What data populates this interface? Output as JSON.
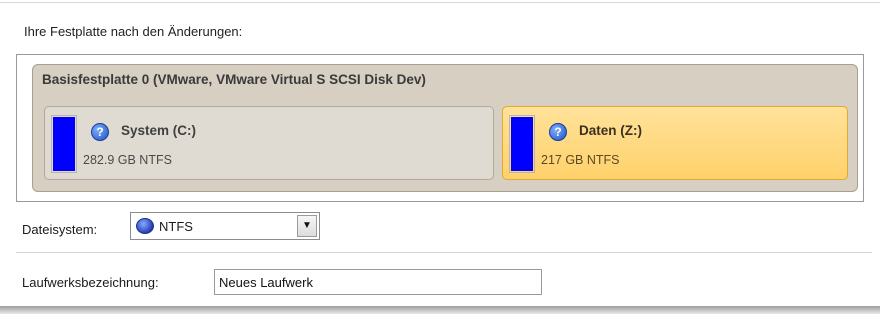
{
  "header": {
    "caption": "Ihre Festplatte nach den Änderungen:"
  },
  "disk": {
    "title": "Basisfestplatte 0 (VMware, VMware Virtual S SCSI Disk Dev)",
    "partitions": [
      {
        "name": "System (C:)",
        "size": "282.9 GB NTFS",
        "selected": false,
        "bar_color": "#0000ff"
      },
      {
        "name": "Daten (Z:)",
        "size": "217 GB NTFS",
        "selected": true,
        "bar_color": "#0000ff"
      }
    ]
  },
  "filesystem": {
    "label": "Dateisystem:",
    "selected": "NTFS",
    "icon": "ntfs-disk-icon"
  },
  "volume_label": {
    "label": "Laufwerksbezeichnung:",
    "value": "Neues Laufwerk"
  },
  "colors": {
    "selected_partition": "#ffd16a",
    "usage_bar": "#0000ff",
    "disk_panel": "#d6cfc2"
  }
}
